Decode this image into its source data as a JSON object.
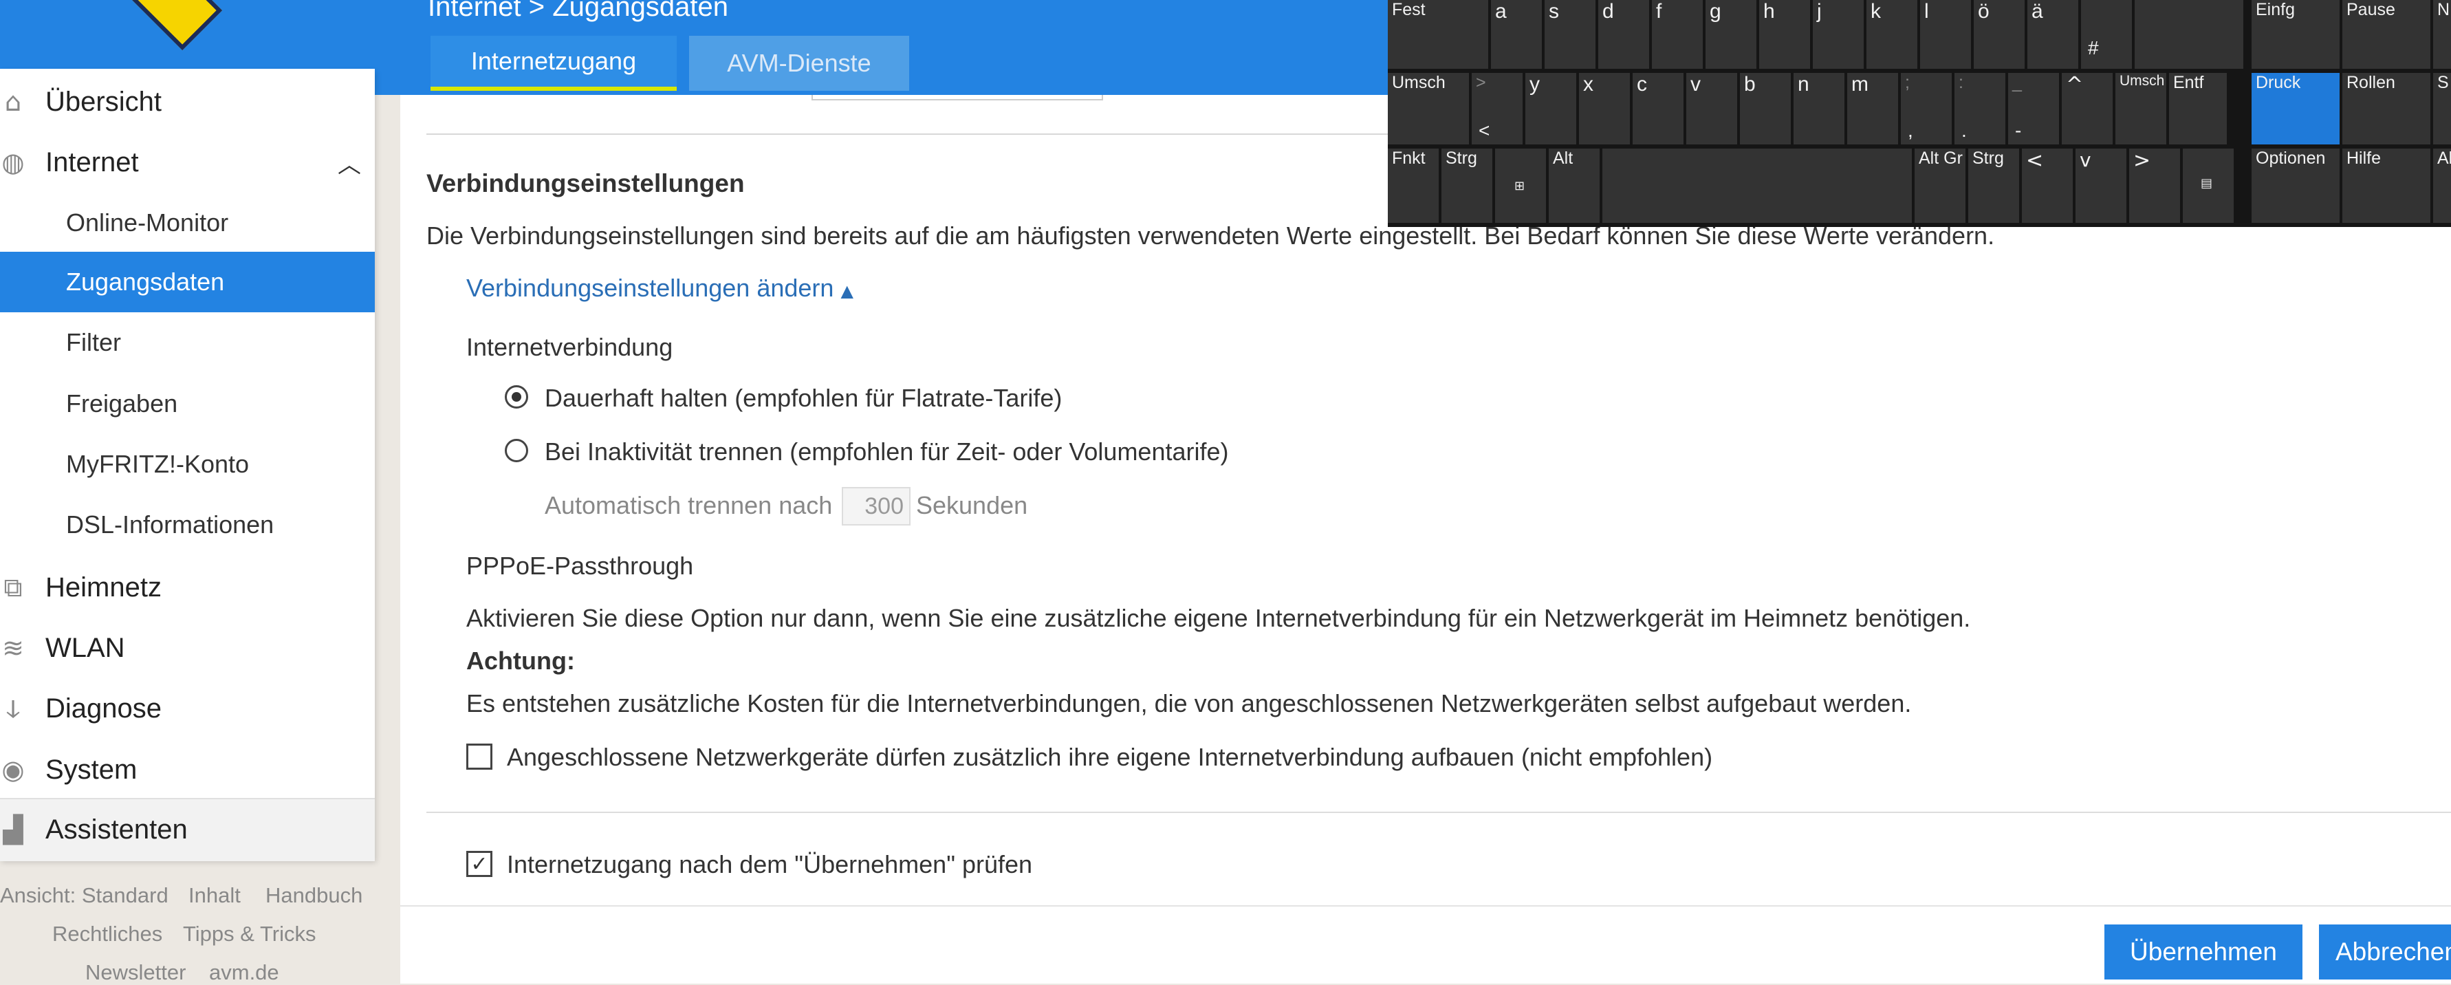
{
  "header": {
    "breadcrumb": "Internet > Zugangsdaten",
    "tabs": [
      {
        "label": "Internetzugang",
        "active": true
      },
      {
        "label": "AVM-Dienste",
        "active": false
      }
    ]
  },
  "sidebar": {
    "items": [
      {
        "label": "Übersicht",
        "icon": "home-icon"
      },
      {
        "label": "Internet",
        "icon": "globe-icon",
        "expanded": true
      },
      {
        "label": "Heimnetz",
        "icon": "network-icon"
      },
      {
        "label": "WLAN",
        "icon": "wifi-icon"
      },
      {
        "label": "Diagnose",
        "icon": "stethoscope-icon"
      },
      {
        "label": "System",
        "icon": "system-icon"
      },
      {
        "label": "Assistenten",
        "icon": "wizard-icon"
      }
    ],
    "sub_items": [
      {
        "label": "Online-Monitor"
      },
      {
        "label": "Zugangsdaten",
        "active": true
      },
      {
        "label": "Filter"
      },
      {
        "label": "Freigaben"
      },
      {
        "label": "MyFRITZ!-Konto"
      },
      {
        "label": "DSL-Informationen"
      }
    ],
    "footer": {
      "row1": [
        "Ansicht: Standard",
        "Inhalt",
        "Handbuch"
      ],
      "row2": [
        "Rechtliches",
        "Tipps & Tricks"
      ],
      "row3": [
        "Newsletter",
        "avm.de"
      ]
    }
  },
  "main": {
    "section_title": "Verbindungseinstellungen",
    "section_desc": "Die Verbindungseinstellungen sind bereits auf die am häufigsten verwendeten Werte eingestellt. Bei Bedarf können Sie diese Werte verändern.",
    "toggle_link": "Verbindungseinstellungen ändern",
    "toggle_icon": "▲",
    "internet_label": "Internetverbindung",
    "radio_options": [
      {
        "label": "Dauerhaft halten (empfohlen für Flatrate-Tarife)",
        "selected": true
      },
      {
        "label": "Bei Inaktivität trennen (empfohlen für Zeit- oder Volumentarife)",
        "selected": false
      }
    ],
    "auto_disconnect_prefix": "Automatisch trennen nach",
    "auto_disconnect_value": "300",
    "auto_disconnect_suffix": "Sekunden",
    "pppoe_label": "PPPoE-Passthrough",
    "pppoe_desc": "Aktivieren Sie diese Option nur dann, wenn Sie eine zusätzliche eigene Internetverbindung für ein Netzwerkgerät im Heimnetz benötigen.",
    "attention_label": "Achtung:",
    "attention_desc": "Es entstehen zusätzliche Kosten für die Internetverbindungen, die von angeschlossenen Netzwerkgeräten selbst aufgebaut werden.",
    "pppoe_checkbox": {
      "label": "Angeschlossene Netzwerkgeräte dürfen zusätzlich ihre eigene Internetverbindung aufbauen (nicht empfohlen)",
      "checked": false
    },
    "check_checkbox": {
      "label": "Internetzugang nach dem \"Übernehmen\" prüfen",
      "checked": true
    },
    "buttons": {
      "apply": "Übernehmen",
      "cancel": "Abbrechen"
    }
  },
  "keyboard": {
    "row1": [
      "Fest",
      "a",
      "s",
      "d",
      "f",
      "g",
      "h",
      "j",
      "k",
      "l",
      "ö",
      "ä",
      "#",
      "Einfg",
      "Pause",
      "N"
    ],
    "row2": [
      "Umsch",
      ">",
      "<",
      "y",
      "x",
      "c",
      "v",
      "b",
      "n",
      "m",
      ";",
      ",",
      ":",
      ".",
      "_",
      "-",
      "^",
      "Umsch",
      "Entf",
      "Druck",
      "Rollen",
      "S"
    ],
    "row3": [
      "Fnkt",
      "Strg",
      "⊞",
      "Alt",
      "Alt Gr",
      "Strg",
      "<",
      "v",
      ">",
      "▤",
      "Optionen",
      "Hilfe",
      "Al"
    ]
  },
  "colors": {
    "accent": "#2383e2",
    "active_tab_underline": "#d8e800",
    "link": "#2a6eb6"
  }
}
